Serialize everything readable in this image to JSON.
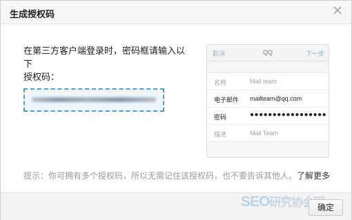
{
  "dialog": {
    "title": "生成授权码",
    "close_icon": "close-icon"
  },
  "instruction": {
    "line1": "在第三方客户端登录时，密码框请输入以下",
    "line2": "授权码："
  },
  "auth_code": {
    "value": ""
  },
  "phone_preview": {
    "cancel": "取消",
    "title": "QQ",
    "next": "下一步",
    "rows": [
      {
        "label": "名称",
        "value": "Mail team"
      },
      {
        "label": "电子邮件",
        "value": "mailteam@qq.com"
      },
      {
        "label": "密码",
        "value": "●●●●●●●●●●●●●●●●●"
      },
      {
        "label": "描述",
        "value": "Mail Team"
      }
    ]
  },
  "hint": {
    "text": "提示：你可拥有多个授权码，所以无需记住该授权码，也不要告诉其他人。",
    "link": "了解更多"
  },
  "footer": {
    "ok_label": "确定",
    "watermark_a": "SEO",
    "watermark_b": "研究协会网"
  },
  "colors": {
    "accent": "#4a9bd6",
    "header_bg": "#f7f7f7",
    "footer_bg": "#f3f3f3"
  }
}
